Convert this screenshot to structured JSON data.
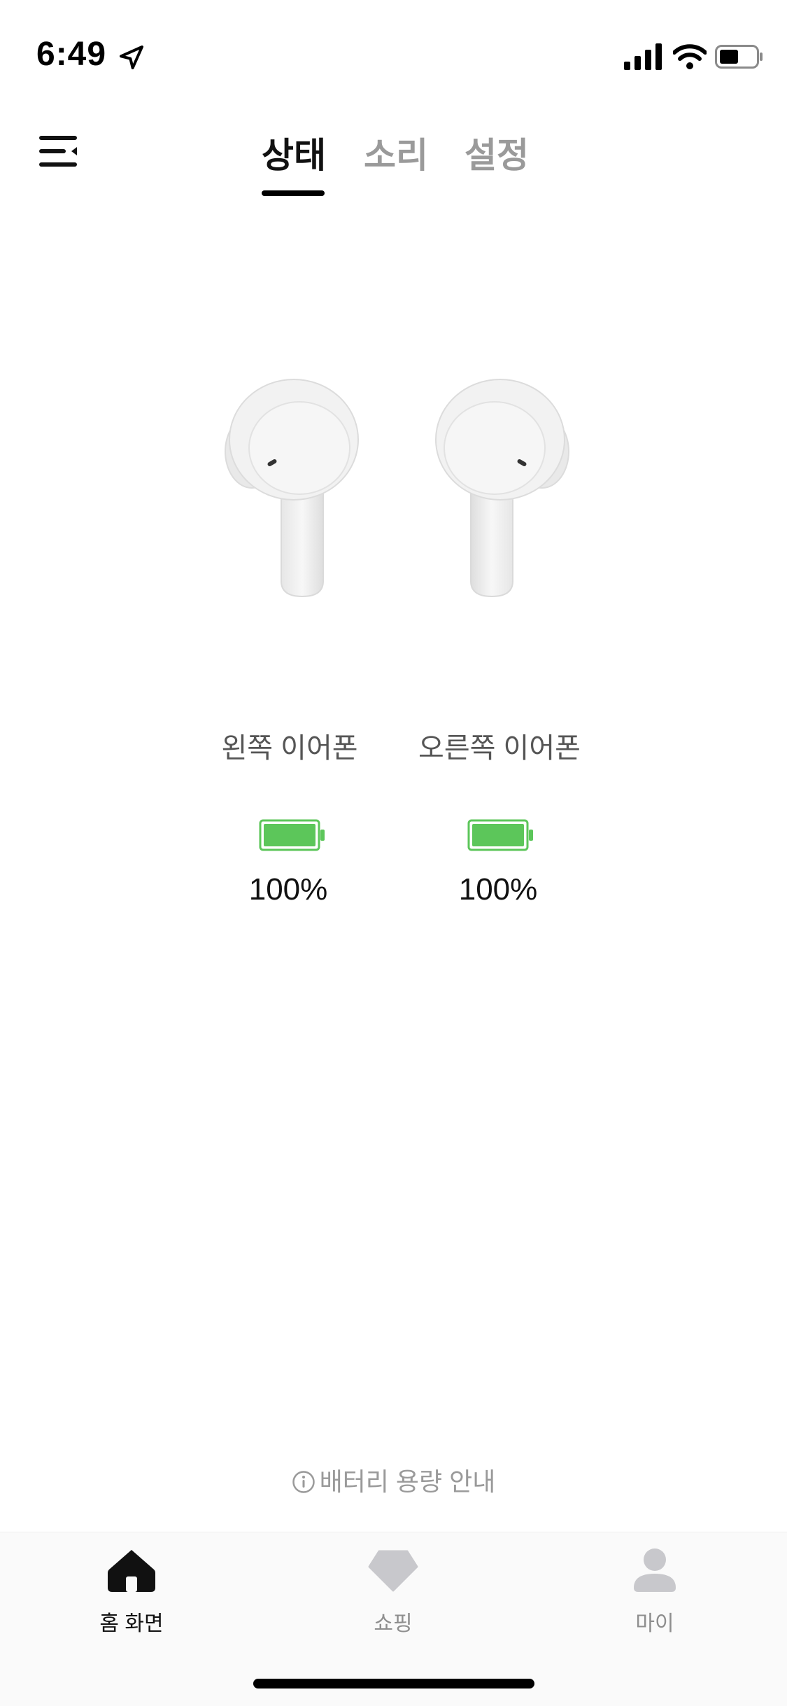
{
  "status_bar": {
    "time": "6:49",
    "icons": [
      "location-arrow-icon",
      "cellular-signal-icon",
      "wifi-icon",
      "battery-icon"
    ]
  },
  "header": {
    "menu_icon": "menu-icon",
    "tabs": [
      {
        "label": "상태",
        "active": true
      },
      {
        "label": "소리",
        "active": false
      },
      {
        "label": "설정",
        "active": false
      }
    ]
  },
  "earbuds": {
    "left": {
      "label": "왼쪽 이어폰",
      "battery": "100%",
      "battery_level": 1.0
    },
    "right": {
      "label": "오른쪽 이어폰",
      "battery": "100%",
      "battery_level": 1.0
    },
    "battery_color": "#5cc65a"
  },
  "battery_info_link": {
    "icon": "info-circle-icon",
    "label": "배터리 용량 안내"
  },
  "bottom_nav": {
    "items": [
      {
        "label": "홈 화면",
        "icon": "home-icon",
        "active": true
      },
      {
        "label": "쇼핑",
        "icon": "diamond-icon",
        "active": false
      },
      {
        "label": "마이",
        "icon": "person-icon",
        "active": false
      }
    ]
  }
}
